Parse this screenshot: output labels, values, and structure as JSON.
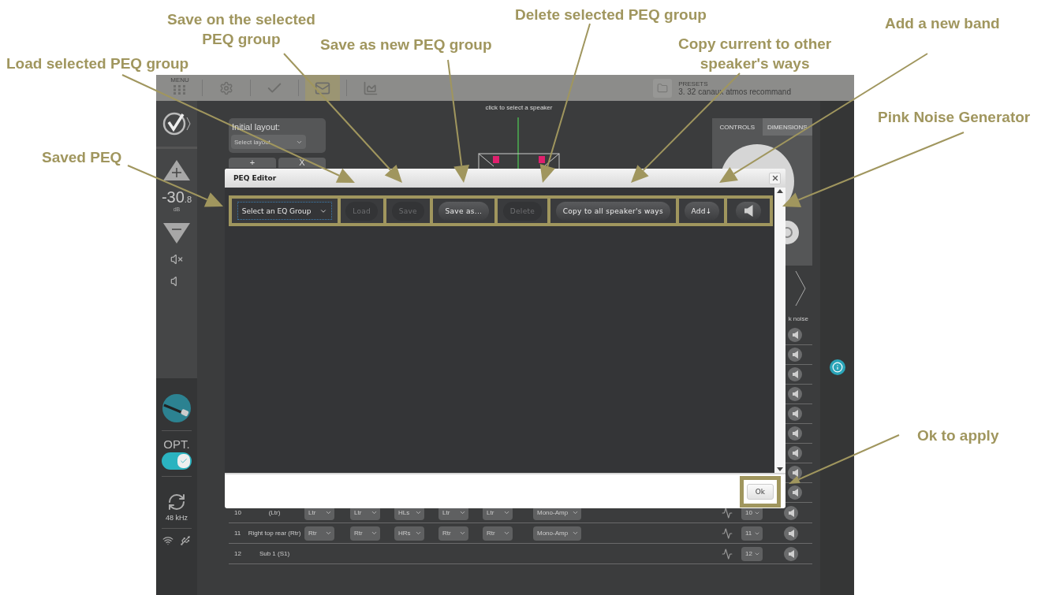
{
  "annotations": [
    {
      "lines": [
        "Load selected PEQ group"
      ]
    },
    {
      "lines": [
        "Save on the selected",
        "PEQ group"
      ]
    },
    {
      "lines": [
        "Save as new PEQ group"
      ]
    },
    {
      "lines": [
        "Delete selected PEQ group"
      ]
    },
    {
      "lines": [
        "Copy current to other",
        "speaker's ways"
      ]
    },
    {
      "lines": [
        "Add a new band"
      ]
    },
    {
      "lines": [
        "Pink Noise Generator"
      ]
    },
    {
      "lines": [
        "Saved PEQ"
      ]
    },
    {
      "lines": [
        "Ok to apply"
      ]
    }
  ],
  "app": {
    "top_bar": {
      "menu_label": "MENU",
      "nav_tabs": [
        {
          "kind": "settings",
          "selected": false
        },
        {
          "kind": "check",
          "selected": false
        },
        {
          "kind": "mail",
          "selected": true
        },
        {
          "kind": "chart",
          "selected": false
        }
      ],
      "presets_label": "PRESETS",
      "preset_name": "3. 32 canaux atmos recommand"
    },
    "sidebar": {
      "volume": "-30",
      "volume_decimal": ".8",
      "volume_unit": "dB",
      "opt_label": "OPT.",
      "opt_on": true,
      "sample_rate": "48 kHz"
    },
    "layout_panel": {
      "label": "Initial layout:",
      "select": "Select layout",
      "buttons": [
        "+",
        "X"
      ]
    },
    "canvas_hint": "click to select a speaker",
    "right_panel": {
      "tabs": [
        {
          "label": "CONTROLS",
          "selected": true
        },
        {
          "label": "DIMENSIONS",
          "selected": false
        }
      ]
    },
    "table": {
      "column_header": "k noise",
      "rows": [
        {
          "number": "10",
          "name": "(Ltr)",
          "selects": [
            "Ltr",
            "Ltr",
            "HLs",
            "Ltr",
            "Ltr",
            "Mono-Amp"
          ],
          "channel": "10"
        },
        {
          "number": "11",
          "name": "Right top rear (Rtr)",
          "selects": [
            "Rtr",
            "Rtr",
            "HRs",
            "Rtr",
            "Rtr",
            "Mono-Amp"
          ],
          "channel": "11"
        },
        {
          "number": "12",
          "name": "Sub 1 (S1)",
          "selects": [],
          "channel": "12"
        }
      ]
    },
    "peq_editor": {
      "title": "PEQ Editor",
      "group_select": "Select an EQ Group",
      "buttons": [
        {
          "label": "Load",
          "disabled": true
        },
        {
          "label": "Save",
          "disabled": true
        },
        {
          "label": "Save as...",
          "disabled": false
        },
        {
          "label": "Delete",
          "disabled": true
        },
        {
          "label": "Copy to all speaker's ways",
          "disabled": false
        },
        {
          "label": "Add↓",
          "disabled": false
        }
      ],
      "ok_button": "Ok"
    }
  }
}
